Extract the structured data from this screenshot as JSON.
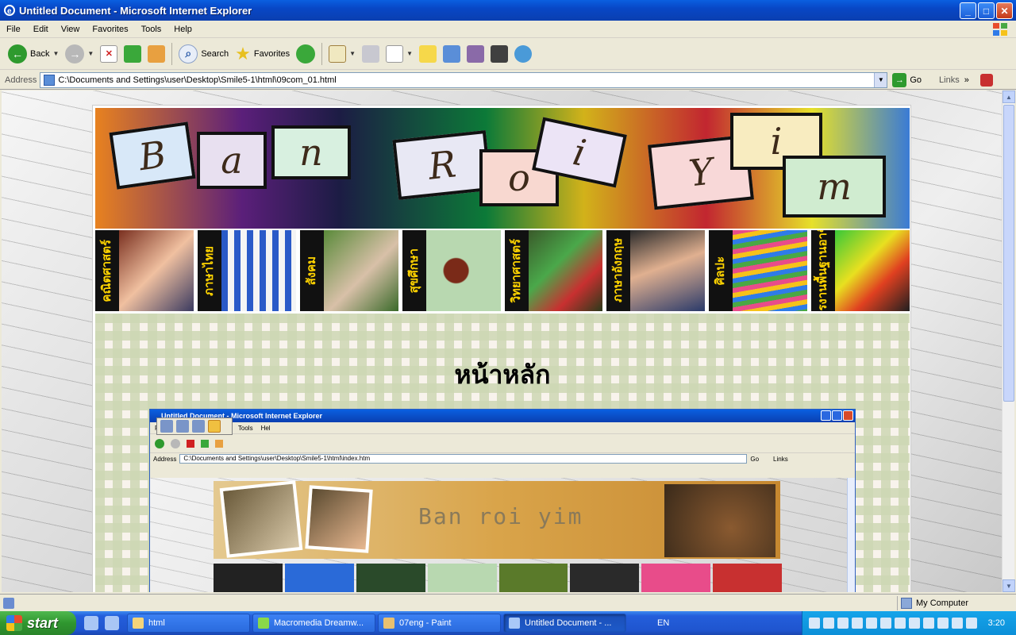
{
  "window": {
    "title": "Untitled Document - Microsoft Internet Explorer"
  },
  "menu": [
    "File",
    "Edit",
    "View",
    "Favorites",
    "Tools",
    "Help"
  ],
  "toolbar": {
    "back": "Back",
    "search": "Search",
    "favorites": "Favorites"
  },
  "address": {
    "label": "Address",
    "url": "C:\\Documents and Settings\\user\\Desktop\\Smile5-1\\html\\09com_01.html",
    "go": "Go",
    "links": "Links"
  },
  "page": {
    "banner_letters": [
      "B",
      "a",
      "n",
      "R",
      "o",
      "i",
      "Y",
      "i",
      "m"
    ],
    "nav_items": [
      "คณิตศาสตร์",
      "ภาษาไทย",
      "สังคม",
      "สุขศึกษา",
      "วิทยาศาสตร์",
      "ภาษาอังกฤษ",
      "ศิลปะ",
      "การงานพื้นฐานอาชีพ"
    ],
    "heading": "หน้าหลัก"
  },
  "nested": {
    "title": "Untitled Document - Microsoft Internet Explorer",
    "menu": [
      "F",
      "Tools",
      "Hel"
    ],
    "address_label": "Address",
    "url": "C:\\Documents and Settings\\user\\Desktop\\Smile5-1\\html\\index.htm",
    "go": "Go",
    "links": "Links",
    "banner_text": "Ban  roi  yim"
  },
  "status": {
    "zone": "My Computer"
  },
  "taskbar": {
    "start": "start",
    "tasks": [
      "html",
      "Macromedia Dreamw...",
      "07eng - Paint",
      "Untitled Document - ..."
    ],
    "lang": "EN",
    "clock": "3:20"
  }
}
